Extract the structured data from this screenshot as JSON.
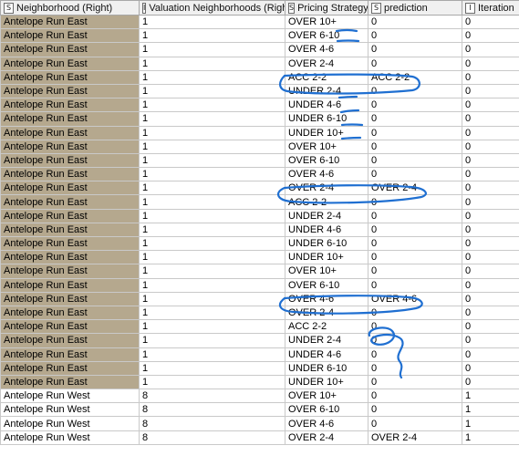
{
  "columns": [
    {
      "type_icon": "S",
      "label": "Neighborhood (Right)"
    },
    {
      "type_icon": "I",
      "label": "Valuation Neighborhoods (Right)"
    },
    {
      "type_icon": "S",
      "label": "Pricing Strategy"
    },
    {
      "type_icon": "S",
      "label": "prediction"
    },
    {
      "type_icon": "I",
      "label": "Iteration"
    }
  ],
  "rows": [
    [
      "Antelope Run East",
      "1",
      "OVER 10+",
      "0",
      "0"
    ],
    [
      "Antelope Run East",
      "1",
      "OVER 6-10",
      "0",
      "0"
    ],
    [
      "Antelope Run East",
      "1",
      "OVER 4-6",
      "0",
      "0"
    ],
    [
      "Antelope Run East",
      "1",
      "OVER 2-4",
      "0",
      "0"
    ],
    [
      "Antelope Run East",
      "1",
      "ACC 2-2",
      "ACC 2-2",
      "0"
    ],
    [
      "Antelope Run East",
      "1",
      "UNDER 2-4",
      "0",
      "0"
    ],
    [
      "Antelope Run East",
      "1",
      "UNDER 4-6",
      "0",
      "0"
    ],
    [
      "Antelope Run East",
      "1",
      "UNDER 6-10",
      "0",
      "0"
    ],
    [
      "Antelope Run East",
      "1",
      "UNDER 10+",
      "0",
      "0"
    ],
    [
      "Antelope Run East",
      "1",
      "OVER 10+",
      "0",
      "0"
    ],
    [
      "Antelope Run East",
      "1",
      "OVER 6-10",
      "0",
      "0"
    ],
    [
      "Antelope Run East",
      "1",
      "OVER 4-6",
      "0",
      "0"
    ],
    [
      "Antelope Run East",
      "1",
      "OVER 2-4",
      "OVER 2-4",
      "0"
    ],
    [
      "Antelope Run East",
      "1",
      "ACC 2-2",
      "0",
      "0"
    ],
    [
      "Antelope Run East",
      "1",
      "UNDER 2-4",
      "0",
      "0"
    ],
    [
      "Antelope Run East",
      "1",
      "UNDER 4-6",
      "0",
      "0"
    ],
    [
      "Antelope Run East",
      "1",
      "UNDER 6-10",
      "0",
      "0"
    ],
    [
      "Antelope Run East",
      "1",
      "UNDER 10+",
      "0",
      "0"
    ],
    [
      "Antelope Run East",
      "1",
      "OVER 10+",
      "0",
      "0"
    ],
    [
      "Antelope Run East",
      "1",
      "OVER 6-10",
      "0",
      "0"
    ],
    [
      "Antelope Run East",
      "1",
      "OVER 4-6",
      "OVER 4-6",
      "0"
    ],
    [
      "Antelope Run East",
      "1",
      "OVER 2-4",
      "0",
      "0"
    ],
    [
      "Antelope Run East",
      "1",
      "ACC 2-2",
      "0",
      "0"
    ],
    [
      "Antelope Run East",
      "1",
      "UNDER 2-4",
      "0",
      "0"
    ],
    [
      "Antelope Run East",
      "1",
      "UNDER 4-6",
      "0",
      "0"
    ],
    [
      "Antelope Run East",
      "1",
      "UNDER 6-10",
      "0",
      "0"
    ],
    [
      "Antelope Run East",
      "1",
      "UNDER 10+",
      "0",
      "0"
    ],
    [
      "Antelope Run West",
      "8",
      "OVER 10+",
      "0",
      "1"
    ],
    [
      "Antelope Run West",
      "8",
      "OVER 6-10",
      "0",
      "1"
    ],
    [
      "Antelope Run West",
      "8",
      "OVER 4-6",
      "0",
      "1"
    ],
    [
      "Antelope Run West",
      "8",
      "OVER 2-4",
      "OVER 2-4",
      "1"
    ]
  ],
  "selected_rows_count": 27,
  "colors": {
    "selected_cell": "#b5a88e",
    "header_bg": "#f0f0f0",
    "grid_line": "#c9c9c9",
    "annotation_ink": "#1f6fd1"
  }
}
